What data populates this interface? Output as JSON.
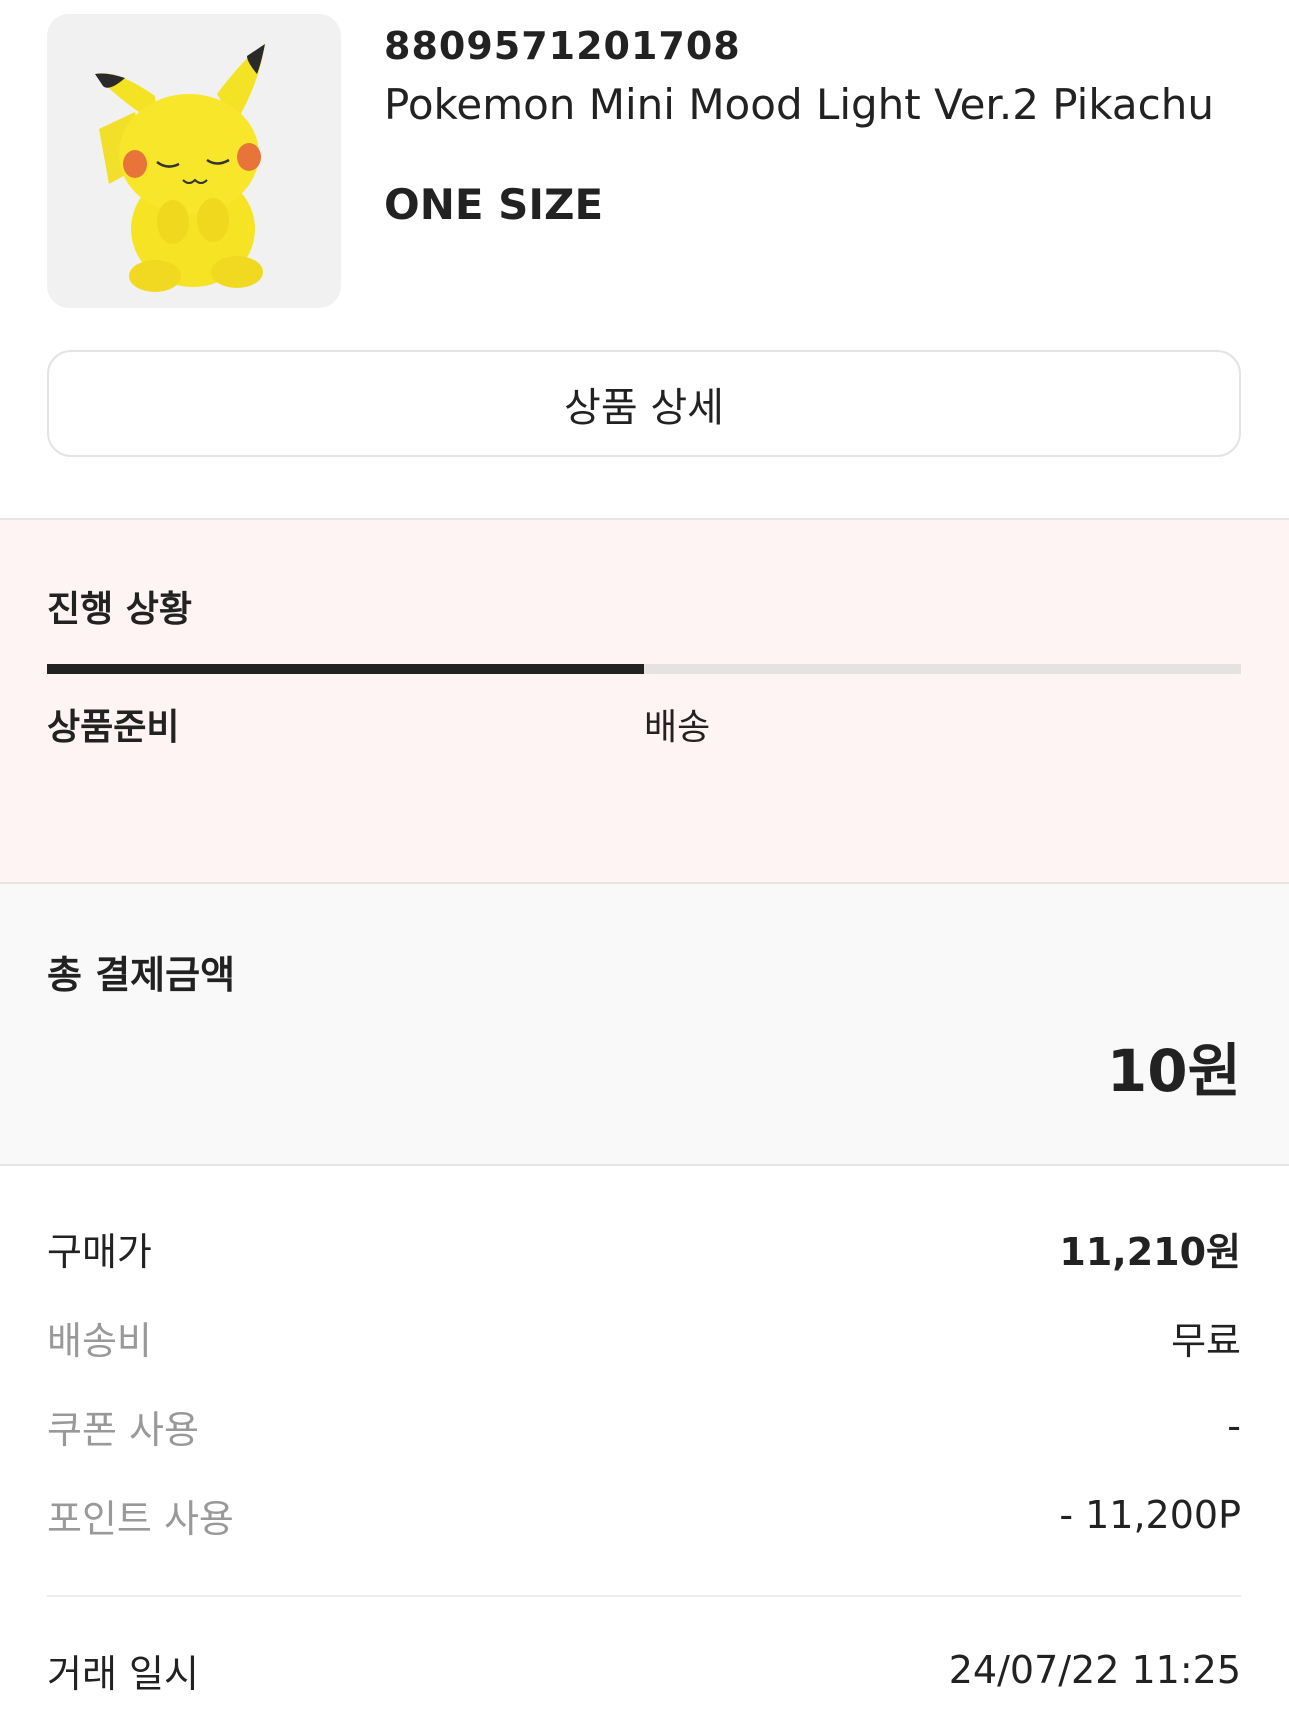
{
  "product": {
    "code": "8809571201708",
    "name": "Pokemon Mini Mood Light Ver.2 Pikachu",
    "size": "ONE SIZE",
    "image_icon": "pikachu-figure-image"
  },
  "detail_button": {
    "label": "상품 상세"
  },
  "progress": {
    "title": "진행 상황",
    "steps": [
      "상품준비",
      "배송"
    ],
    "fraction_complete": 0.5,
    "colors": {
      "background": "#fef4f3",
      "fill": "#222222",
      "track": "#e6e2e1"
    }
  },
  "total": {
    "label": "총 결제금액",
    "value": "10원"
  },
  "breakdown": [
    {
      "label": "구매가",
      "value": "11,210원"
    },
    {
      "label": "배송비",
      "value": "무료"
    },
    {
      "label": "쿠폰 사용",
      "value": "-"
    },
    {
      "label": "포인트 사용",
      "value": "- 11,200P"
    }
  ],
  "transaction": {
    "label": "거래 일시",
    "value": "24/07/22 11:25"
  }
}
